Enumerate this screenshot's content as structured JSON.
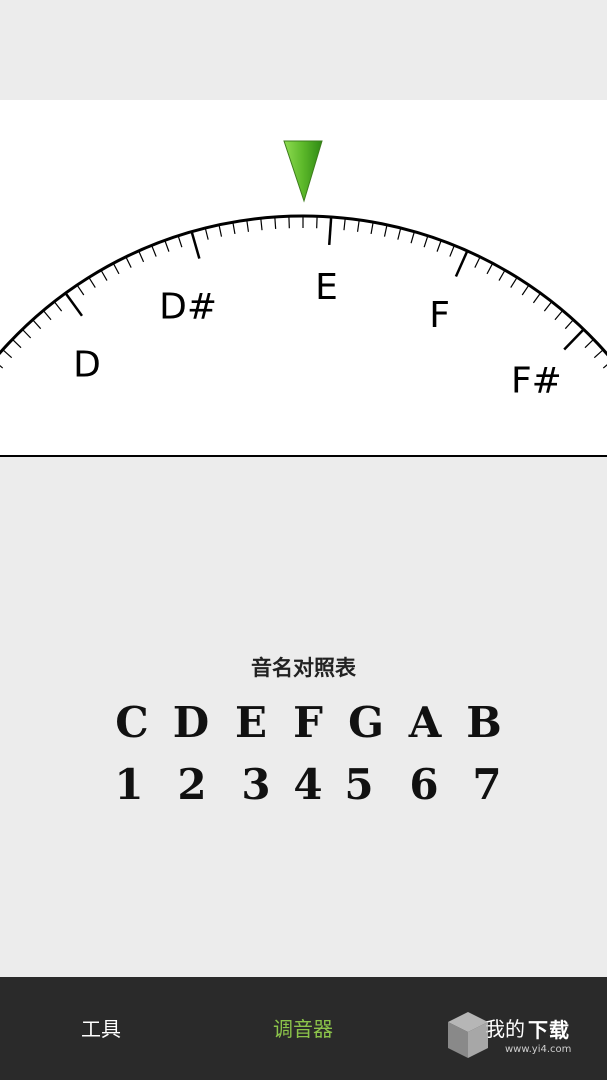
{
  "tuner": {
    "notes": [
      "D",
      "D#",
      "E",
      "F",
      "F#"
    ],
    "indicator_color": "#5cb82a",
    "current_note": "E"
  },
  "reference": {
    "title": "音名对照表",
    "letters": [
      "C",
      "D",
      "E",
      "F",
      "G",
      "A",
      "B"
    ],
    "numbers": [
      "1",
      "2",
      "3",
      "4",
      "5",
      "6",
      "7"
    ]
  },
  "nav": {
    "tools_label": "工具",
    "tuner_label": "调音器",
    "mine_label": "我的",
    "active_color": "#8bc34a"
  },
  "watermark": {
    "text": "下载",
    "url": "www.yi4.com"
  }
}
